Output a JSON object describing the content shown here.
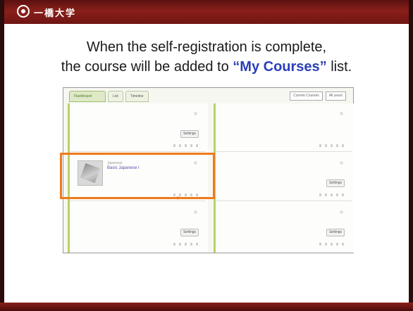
{
  "header": {
    "logo_text": "一橋大学",
    "bar_color": "#8a1f1a"
  },
  "caption": {
    "line1": "When the self-registration is complete,",
    "line2_pre": "the course will be added to ",
    "line2_highlight": "“My Courses”",
    "line2_post": " list.",
    "highlight_color": "#2a3fb8"
  },
  "screenshot": {
    "tabs": [
      {
        "label": "Flashboard",
        "active": true
      },
      {
        "label": "List",
        "active": false
      },
      {
        "label": "Timeline",
        "active": false
      }
    ],
    "selects": [
      "Current Courses",
      "All years"
    ],
    "settings_label": "Settings",
    "course": {
      "category": "Japanese",
      "name": "Basic Japanese I"
    },
    "icons": {
      "heart": "heart-icon"
    }
  },
  "highlight": {
    "color": "#f07a1d"
  }
}
